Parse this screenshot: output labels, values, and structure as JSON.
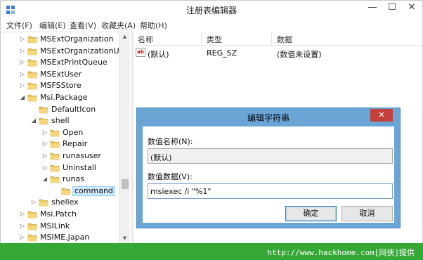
{
  "window": {
    "title": "注册表编辑器",
    "minimize": "—",
    "maximize": "☐",
    "close": "✕"
  },
  "menu": [
    "文件(F)",
    "编辑(E)",
    "查看(V)",
    "收藏夹(A)",
    "帮助(H)"
  ],
  "tree": [
    {
      "label": "MSExtOrganization",
      "expander": "collapsed",
      "selected": false
    },
    {
      "label": "MSExtOrganizationU",
      "expander": "collapsed",
      "selected": false
    },
    {
      "label": "MSExtPrintQueue",
      "expander": "collapsed",
      "selected": false
    },
    {
      "label": "MSExtUser",
      "expander": "collapsed",
      "selected": false
    },
    {
      "label": "MSFSStore",
      "expander": "collapsed",
      "selected": false
    },
    {
      "label": "Msi.Package",
      "expander": "expanded",
      "selected": false
    },
    {
      "label": "DefaultIcon",
      "expander": "none",
      "selected": false
    },
    {
      "label": "shell",
      "expander": "expanded",
      "selected": false
    },
    {
      "label": "Open",
      "expander": "collapsed",
      "selected": false
    },
    {
      "label": "Repair",
      "expander": "collapsed",
      "selected": false
    },
    {
      "label": "runasuser",
      "expander": "collapsed",
      "selected": false
    },
    {
      "label": "Uninstall",
      "expander": "collapsed",
      "selected": false
    },
    {
      "label": "runas",
      "expander": "expanded",
      "selected": false
    },
    {
      "label": "command",
      "expander": "none",
      "selected": true
    },
    {
      "label": "shellex",
      "expander": "collapsed",
      "selected": false
    },
    {
      "label": "Msi.Patch",
      "expander": "collapsed",
      "selected": false
    },
    {
      "label": "MSILink",
      "expander": "collapsed",
      "selected": false
    },
    {
      "label": "MSIME.Japan",
      "expander": "collapsed",
      "selected": false
    }
  ],
  "list": {
    "columns": [
      "名称",
      "类型",
      "数据"
    ],
    "rows": [
      {
        "icon": "ab",
        "name": "(默认)",
        "type": "REG_SZ",
        "data": "(数值未设置)"
      }
    ]
  },
  "dialog": {
    "title": "编辑字符串",
    "close": "✕",
    "name_label": "数值名称(N):",
    "name_value": "(默认)",
    "data_label": "数值数据(V):",
    "data_value": "msiexec /i \"%1\"",
    "ok_label": "确定",
    "cancel_label": "取消"
  },
  "footer": {
    "text": "http://www.hackhome.com[网侠]提供"
  },
  "colors": {
    "dialog_frame": "#6aa5d6",
    "close_button": "#c7413c",
    "footer_bar": "#36a836",
    "folder": "#e8c25a"
  }
}
